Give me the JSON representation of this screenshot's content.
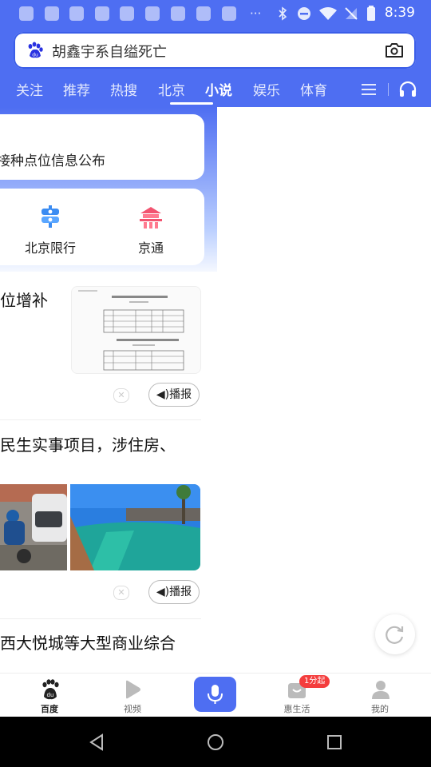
{
  "status_bar": {
    "time": "8:39",
    "notification_icons": [
      "baidu-paw",
      "baidu-paw",
      "baidu-paw",
      "baidu-paw",
      "baidu-paw",
      "baidu-paw",
      "baidu-paw",
      "baidu-paw"
    ],
    "more": "···"
  },
  "search": {
    "query": "胡鑫宇系自缢死亡"
  },
  "tabs": [
    {
      "label": "关注"
    },
    {
      "label": "推荐"
    },
    {
      "label": "热搜"
    },
    {
      "label": "北京"
    },
    {
      "label": "小说",
      "active": true
    },
    {
      "label": "娱乐"
    },
    {
      "label": "体育"
    }
  ],
  "cards": {
    "top_text": "接种点位信息公布",
    "services": [
      {
        "label": "北京限行",
        "icon": "traffic-light-icon"
      },
      {
        "label": "京通",
        "icon": "temple-icon"
      }
    ]
  },
  "news": [
    {
      "title": "位增补",
      "broadcast": "播报"
    },
    {
      "title": "民生实事项目，涉住房、",
      "broadcast": "播报"
    },
    {
      "title": "西大悦城等大型商业综合"
    }
  ],
  "bottom_nav": [
    {
      "label": "百度",
      "icon": "baidu-icon",
      "active": true
    },
    {
      "label": "视频",
      "icon": "video-icon"
    },
    {
      "label": "",
      "icon": "mic-icon"
    },
    {
      "label": "惠生活",
      "icon": "life-icon",
      "badge": "1分起"
    },
    {
      "label": "我的",
      "icon": "person-icon"
    }
  ],
  "colors": {
    "brand_blue": "#4e6ef2",
    "badge_red": "#f43d3d"
  }
}
